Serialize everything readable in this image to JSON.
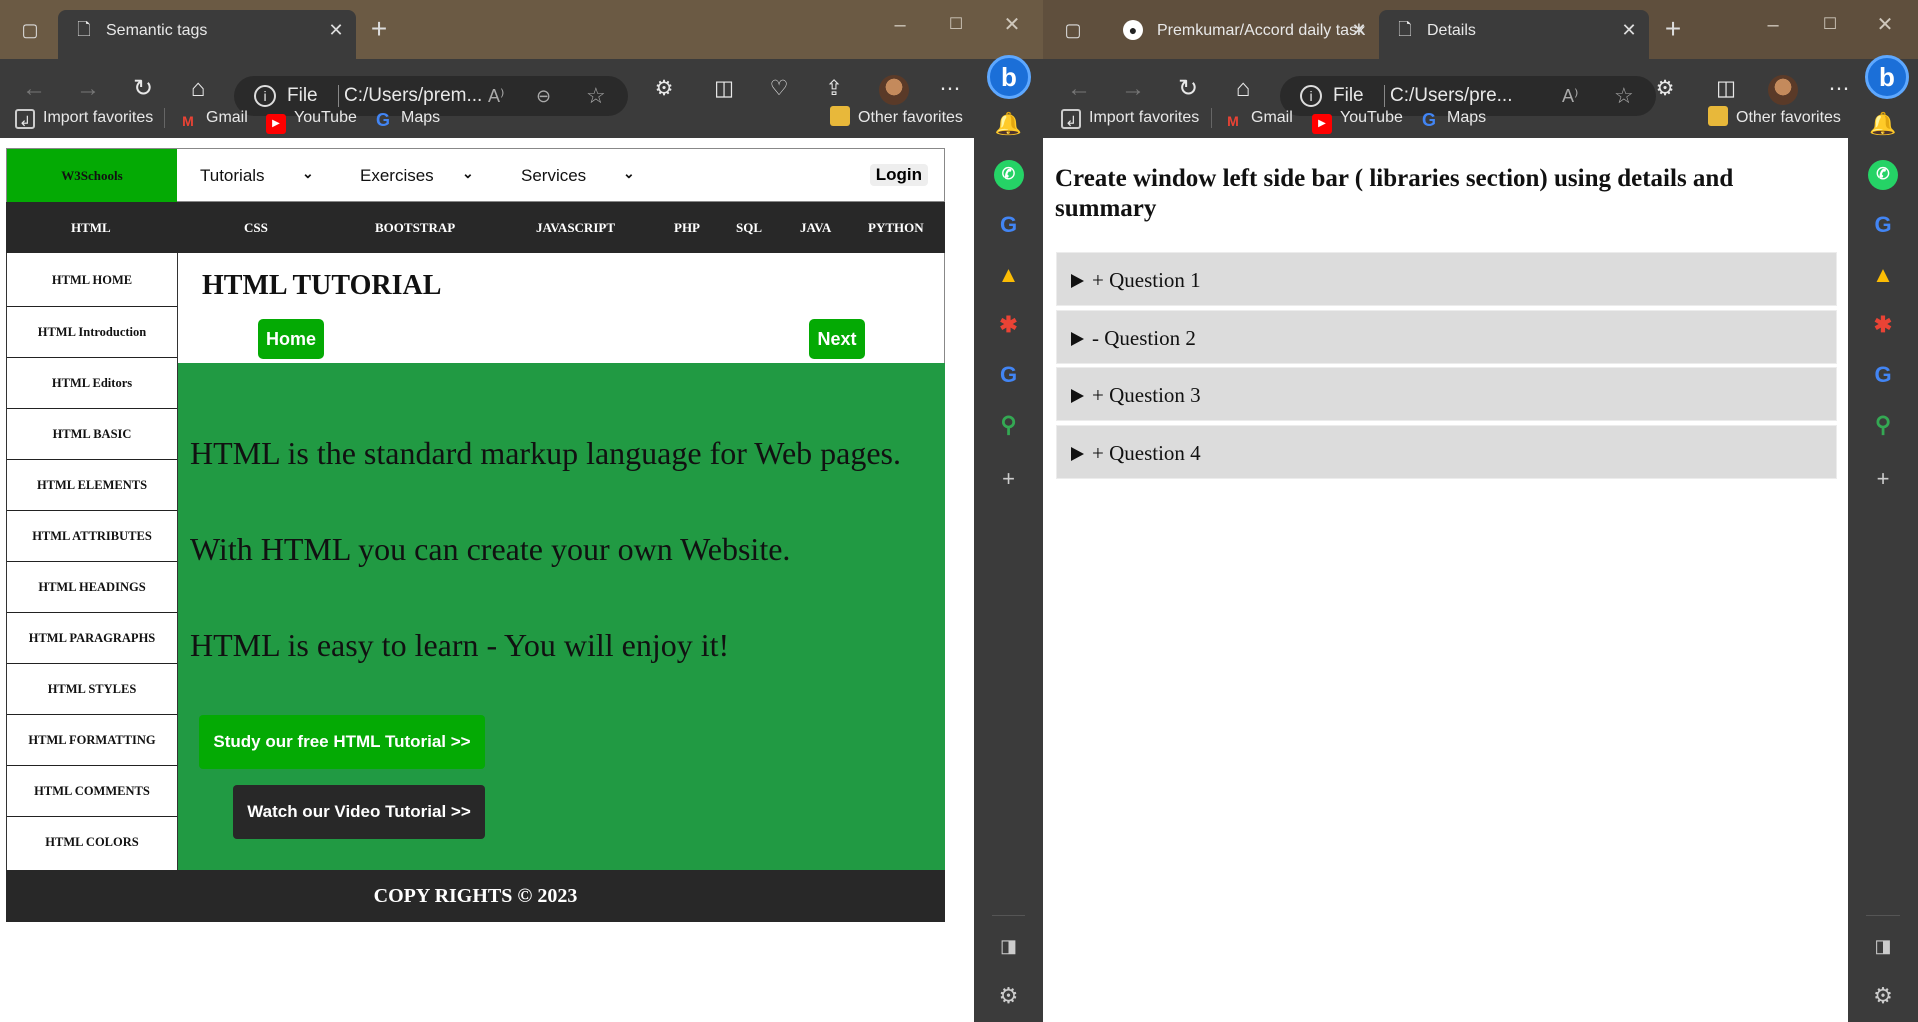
{
  "left_window": {
    "tab": {
      "title": "Semantic tags",
      "icon": "page-icon"
    },
    "address": {
      "scheme": "File",
      "url": "C:/Users/prem..."
    },
    "favorites": [
      {
        "label": "Import favorites",
        "icon": "import-icon"
      },
      {
        "label": "Gmail",
        "icon": "gmail-icon"
      },
      {
        "label": "YouTube",
        "icon": "youtube-icon"
      },
      {
        "label": "Maps",
        "icon": "google-icon"
      }
    ],
    "other_favorites": "Other favorites",
    "page": {
      "logo": "W3Schools",
      "header_nav": [
        "Tutorials",
        "Exercises",
        "Services"
      ],
      "login": "Login",
      "top_nav": [
        "HTML",
        "CSS",
        "BOOTSTRAP",
        "JAVASCRIPT",
        "PHP",
        "SQL",
        "JAVA",
        "PYTHON"
      ],
      "left_nav": [
        "HTML HOME",
        "HTML Introduction",
        "HTML Editors",
        "HTML BASIC",
        "HTML ELEMENTS",
        "HTML ATTRIBUTES",
        "HTML HEADINGS",
        "HTML PARAGRAPHS",
        "HTML STYLES",
        "HTML FORMATTING",
        "HTML COMMENTS",
        "HTML COLORS"
      ],
      "tutorial_title": "HTML TUTORIAL",
      "home_btn": "Home",
      "next_btn": "Next",
      "paragraphs": [
        "HTML is the standard markup language for Web pages.",
        "With HTML you can create your own Website.",
        "HTML is easy to learn - You will enjoy it!"
      ],
      "study_btn": "Study our free HTML Tutorial >>",
      "video_btn": "Watch our Video Tutorial >>",
      "footer": "COPY RIGHTS © 2023"
    }
  },
  "right_window": {
    "tabs": [
      {
        "title": "Premkumar/Accord daily task",
        "icon": "github-icon"
      },
      {
        "title": "Details",
        "icon": "page-icon"
      }
    ],
    "address": {
      "scheme": "File",
      "url": "C:/Users/pre..."
    },
    "favorites": [
      {
        "label": "Import favorites",
        "icon": "import-icon"
      },
      {
        "label": "Gmail",
        "icon": "gmail-icon"
      },
      {
        "label": "YouTube",
        "icon": "youtube-icon"
      },
      {
        "label": "Maps",
        "icon": "google-icon"
      }
    ],
    "other_favorites": "Other favorites",
    "page": {
      "title": "Create window left side bar ( libraries section) using details and summary",
      "details": [
        "+ Question 1",
        "- Question 2",
        "+ Question 3",
        "+ Question 4"
      ]
    }
  },
  "colors": {
    "w3_green": "#04aa04",
    "content_green": "#219a43",
    "dark_nav": "#282828",
    "details_bg": "#dcdcdc"
  }
}
